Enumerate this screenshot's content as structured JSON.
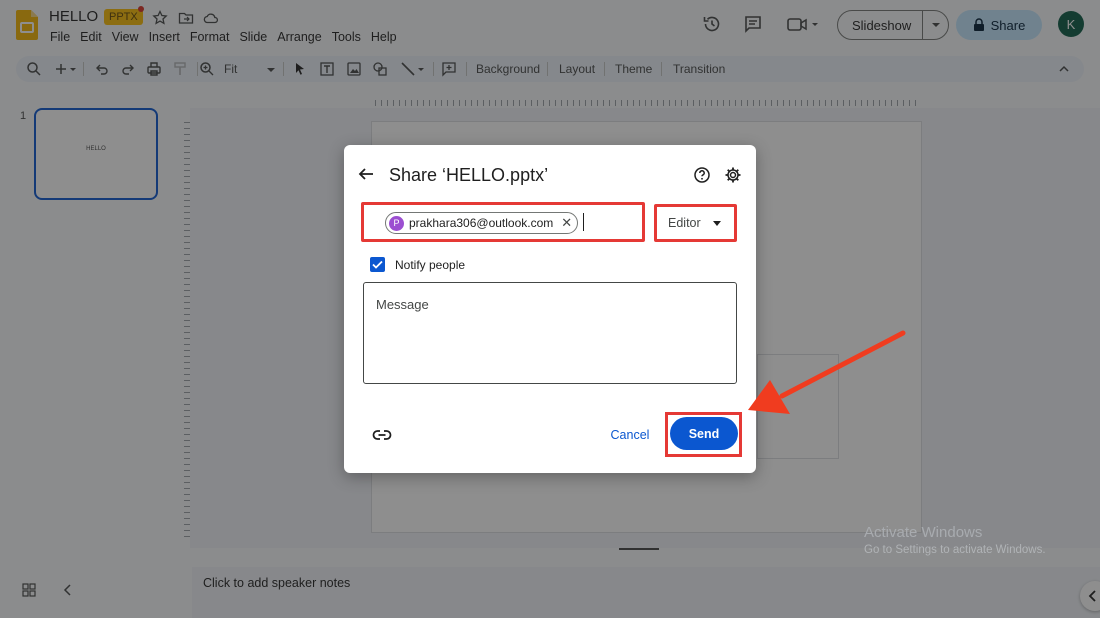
{
  "header": {
    "doc_title": "HELLO",
    "badge": "PPTX",
    "menu": [
      "File",
      "Edit",
      "View",
      "Insert",
      "Format",
      "Slide",
      "Arrange",
      "Tools",
      "Help"
    ],
    "slideshow_label": "Slideshow",
    "share_label": "Share",
    "avatar_initial": "K"
  },
  "toolbar": {
    "zoom": "Fit",
    "buttons": [
      "Background",
      "Layout",
      "Theme",
      "Transition"
    ]
  },
  "filmstrip": {
    "slides": [
      {
        "number": "1",
        "thumb_text": "HELLO"
      }
    ]
  },
  "notes": {
    "placeholder": "Click to add speaker notes"
  },
  "watermark": {
    "title": "Activate Windows",
    "subtitle": "Go to Settings to activate Windows."
  },
  "dialog": {
    "title": "Share ‘HELLO.pptx’",
    "recipient": {
      "initial": "P",
      "email": "prakhara306@outlook.com"
    },
    "role": "Editor",
    "notify_label": "Notify people",
    "notify_checked": true,
    "message_placeholder": "Message",
    "cancel_label": "Cancel",
    "send_label": "Send"
  },
  "colors": {
    "accent": "#0b57d0",
    "annotation": "#e53935",
    "share_bg": "#c2e7ff",
    "badge": "#fbbc04"
  }
}
